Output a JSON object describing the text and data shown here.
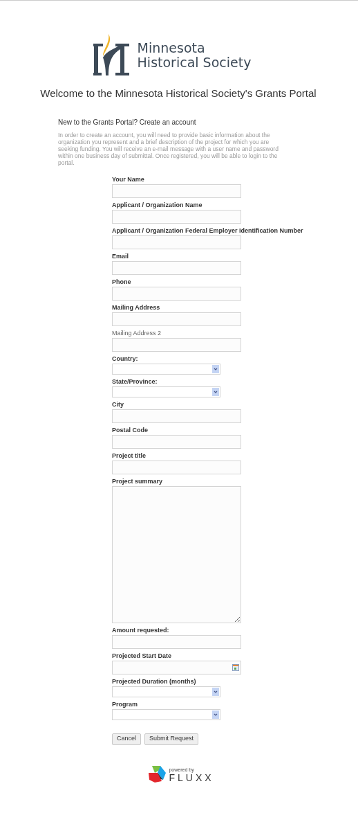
{
  "logo": {
    "line_1": "Minnesota",
    "line_2": "Historical Society"
  },
  "title": "Welcome to the Minnesota Historical Society's Grants Portal",
  "intro": {
    "heading": "New to the Grants Portal? Create an account",
    "text": "In order to create an account, you will need to provide basic information about the organization you represent and a brief description of the project for which you are seeking funding. You will receive an e-mail message with a user name and password within one business day of submittal. Once registered, you will be able to login to the portal."
  },
  "fields": [
    {
      "label": "Your Name",
      "kind": "text",
      "bold": true
    },
    {
      "label": "Applicant / Organization Name",
      "kind": "text",
      "bold": true
    },
    {
      "label": "Applicant / Organization Federal Employer Identification Number",
      "kind": "text",
      "bold": true
    },
    {
      "label": "Email",
      "kind": "text",
      "bold": true
    },
    {
      "label": "Phone",
      "kind": "text",
      "bold": true
    },
    {
      "label": "Mailing Address",
      "kind": "text",
      "bold": true
    },
    {
      "label": "Mailing Address 2",
      "kind": "text",
      "bold": false
    },
    {
      "label": "Country:",
      "kind": "select",
      "bold": true
    },
    {
      "label": "State/Province:",
      "kind": "select",
      "bold": true
    },
    {
      "label": "City",
      "kind": "text",
      "bold": true
    },
    {
      "label": "Postal Code",
      "kind": "text",
      "bold": true
    },
    {
      "label": "Project title",
      "kind": "text",
      "bold": true
    },
    {
      "label": "Project summary",
      "kind": "textarea",
      "bold": true
    },
    {
      "label": "Amount requested:",
      "kind": "text",
      "bold": true
    },
    {
      "label": "Projected Start Date",
      "kind": "date",
      "bold": true
    },
    {
      "label": "Projected Duration (months)",
      "kind": "select",
      "bold": true
    },
    {
      "label": "Program",
      "kind": "select",
      "bold": true
    }
  ],
  "buttons": [
    "Cancel",
    "Submit Request"
  ],
  "footer": {
    "powered_by": "powered by",
    "brand": "FLUXX"
  }
}
